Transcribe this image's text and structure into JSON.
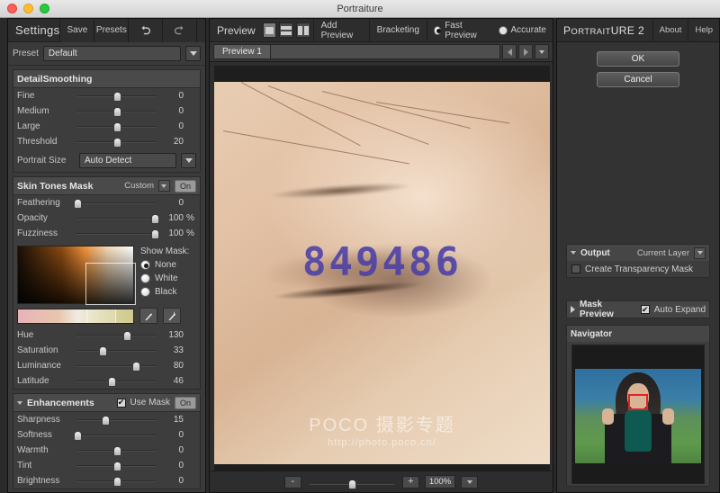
{
  "window": {
    "title": "Portraiture"
  },
  "settings": {
    "title": "Settings",
    "save_label": "Save",
    "presets_label": "Presets",
    "undo_icon": "undo-icon",
    "redo_icon": "redo-icon",
    "menu_icon": "chevron-down-icon",
    "preset_label": "Preset",
    "preset_value": "Default",
    "detail_smoothing": {
      "title": "DetailSmoothing",
      "sliders": [
        {
          "label": "Fine",
          "value": "0",
          "pct": 50
        },
        {
          "label": "Medium",
          "value": "0",
          "pct": 50
        },
        {
          "label": "Large",
          "value": "0",
          "pct": 50
        },
        {
          "label": "Threshold",
          "value": "20",
          "pct": 50
        }
      ],
      "portrait_size_label": "Portrait Size",
      "portrait_size_value": "Auto Detect"
    },
    "skin_tones_mask": {
      "title": "Skin Tones Mask",
      "preset": "Custom",
      "toggle": "On",
      "sliders": [
        {
          "label": "Feathering",
          "value": "0",
          "unit": "",
          "pct": 3
        },
        {
          "label": "Opacity",
          "value": "100",
          "unit": "%",
          "pct": 97
        },
        {
          "label": "Fuzziness",
          "value": "100",
          "unit": "%",
          "pct": 97
        }
      ],
      "show_mask_label": "Show Mask:",
      "show_mask_options": [
        {
          "label": "None",
          "selected": true
        },
        {
          "label": "White",
          "selected": false
        },
        {
          "label": "Black",
          "selected": false
        }
      ],
      "picker_icon": "eyedropper-icon",
      "picker_plus_icon": "eyedropper-plus-icon",
      "tone_sliders": [
        {
          "label": "Hue",
          "value": "130",
          "pct": 62
        },
        {
          "label": "Saturation",
          "value": "33",
          "pct": 33
        },
        {
          "label": "Luminance",
          "value": "80",
          "pct": 73
        },
        {
          "label": "Latitude",
          "value": "46",
          "pct": 44
        }
      ]
    },
    "enhancements": {
      "title": "Enhancements",
      "use_mask_label": "Use Mask",
      "use_mask_checked": true,
      "toggle": "On",
      "collapse_icon": "chevron-down-icon",
      "sliders": [
        {
          "label": "Sharpness",
          "value": "15",
          "pct": 37
        },
        {
          "label": "Softness",
          "value": "0",
          "pct": 3
        },
        {
          "label": "Warmth",
          "value": "0",
          "pct": 50
        },
        {
          "label": "Tint",
          "value": "0",
          "pct": 50
        },
        {
          "label": "Brightness",
          "value": "0",
          "pct": 50
        }
      ]
    }
  },
  "preview": {
    "title": "Preview",
    "view_modes": [
      {
        "name": "single-view",
        "active": true
      },
      {
        "name": "horizontal-split-view",
        "active": false
      },
      {
        "name": "vertical-split-view",
        "active": false
      }
    ],
    "add_preview_label": "Add Preview",
    "bracketing_label": "Bracketing",
    "quality_options": [
      {
        "label": "Fast Preview",
        "selected": true
      },
      {
        "label": "Accurate",
        "selected": false
      }
    ],
    "tab_label": "Preview 1",
    "prev_icon": "chevron-left-icon",
    "next_icon": "chevron-right-icon",
    "tab_menu_icon": "chevron-down-icon",
    "watermark_number": "849486",
    "watermark_brand": "POCO 摄影专题",
    "watermark_url": "http://photo.poco.cn/",
    "zoom_out_label": "-",
    "zoom_in_label": "+",
    "zoom_value": "100%",
    "zoom_pct": 50
  },
  "right": {
    "brand_first": "P",
    "brand_rest": "ORTRAIT",
    "brand_bold": "URE",
    "brand_num": "2",
    "about_label": "About",
    "help_label": "Help",
    "ok_label": "OK",
    "cancel_label": "Cancel",
    "output": {
      "title": "Output",
      "target": "Current Layer",
      "transparency_label": "Create Transparency Mask",
      "transparency_checked": false
    },
    "mask_preview": {
      "title": "Mask Preview",
      "auto_expand_label": "Auto Expand",
      "auto_expand_checked": true
    },
    "navigator": {
      "title": "Navigator"
    }
  },
  "colors": {
    "panel_bg": "#3a3a3a",
    "header_bg": "#2d2d2d",
    "accent_watermark": "#4b3fa8",
    "nav_selection": "#e02424"
  }
}
